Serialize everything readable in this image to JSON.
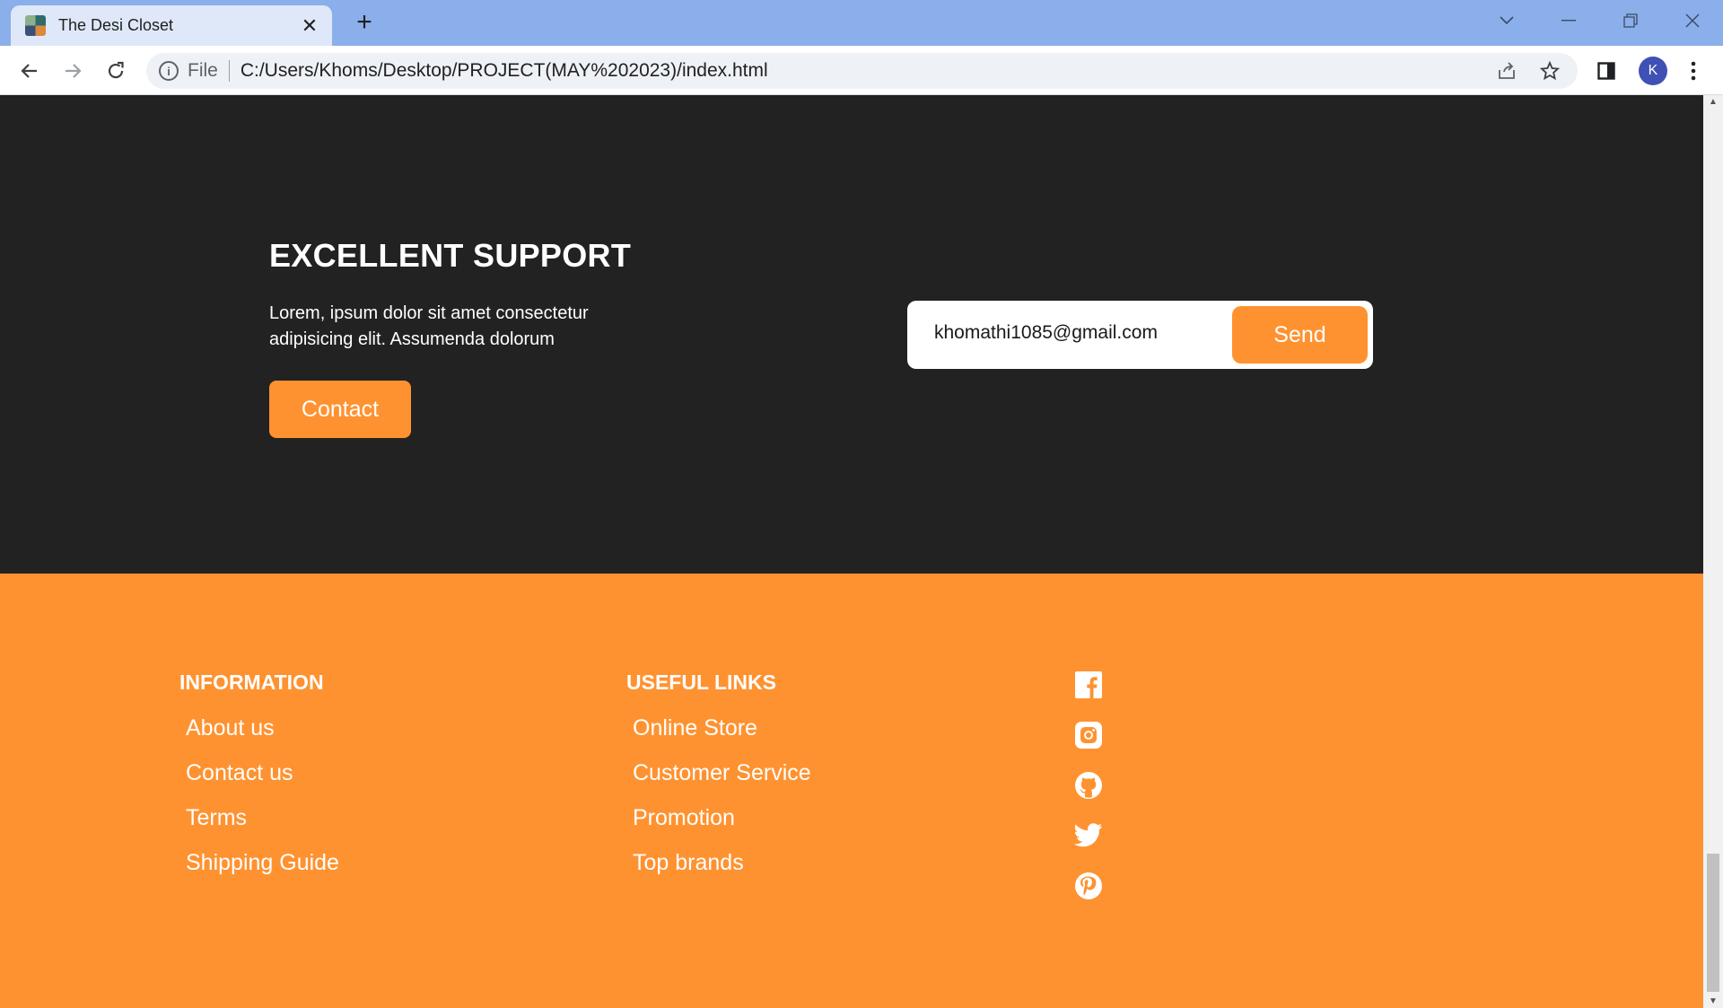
{
  "browser": {
    "tab_title": "The Desi Closet",
    "tab_close": "✕",
    "new_tab": "+",
    "url_scheme": "File",
    "url": "C:/Users/Khoms/Desktop/PROJECT(MAY%202023)/index.html",
    "profile_initial": "K"
  },
  "support": {
    "heading": "EXCELLENT SUPPORT",
    "text": "Lorem, ipsum dolor sit amet consectetur adipisicing elit. Assumenda dolorum",
    "contact_label": "Contact",
    "email_value": "khomathi1085@gmail.com",
    "send_label": "Send"
  },
  "footer": {
    "information": {
      "heading": "INFORMATION",
      "links": [
        "About us",
        "Contact us",
        "Terms",
        "Shipping Guide"
      ]
    },
    "useful_links": {
      "heading": "USEFUL LINKS",
      "links": [
        "Online Store",
        "Customer Service",
        "Promotion",
        "Top brands"
      ]
    },
    "social_icons": [
      "facebook-icon",
      "instagram-icon",
      "github-icon",
      "twitter-icon",
      "pinterest-icon"
    ]
  },
  "colors": {
    "accent": "#ff9230",
    "dark_section": "#222222",
    "tabstrip": "#8aafea"
  }
}
